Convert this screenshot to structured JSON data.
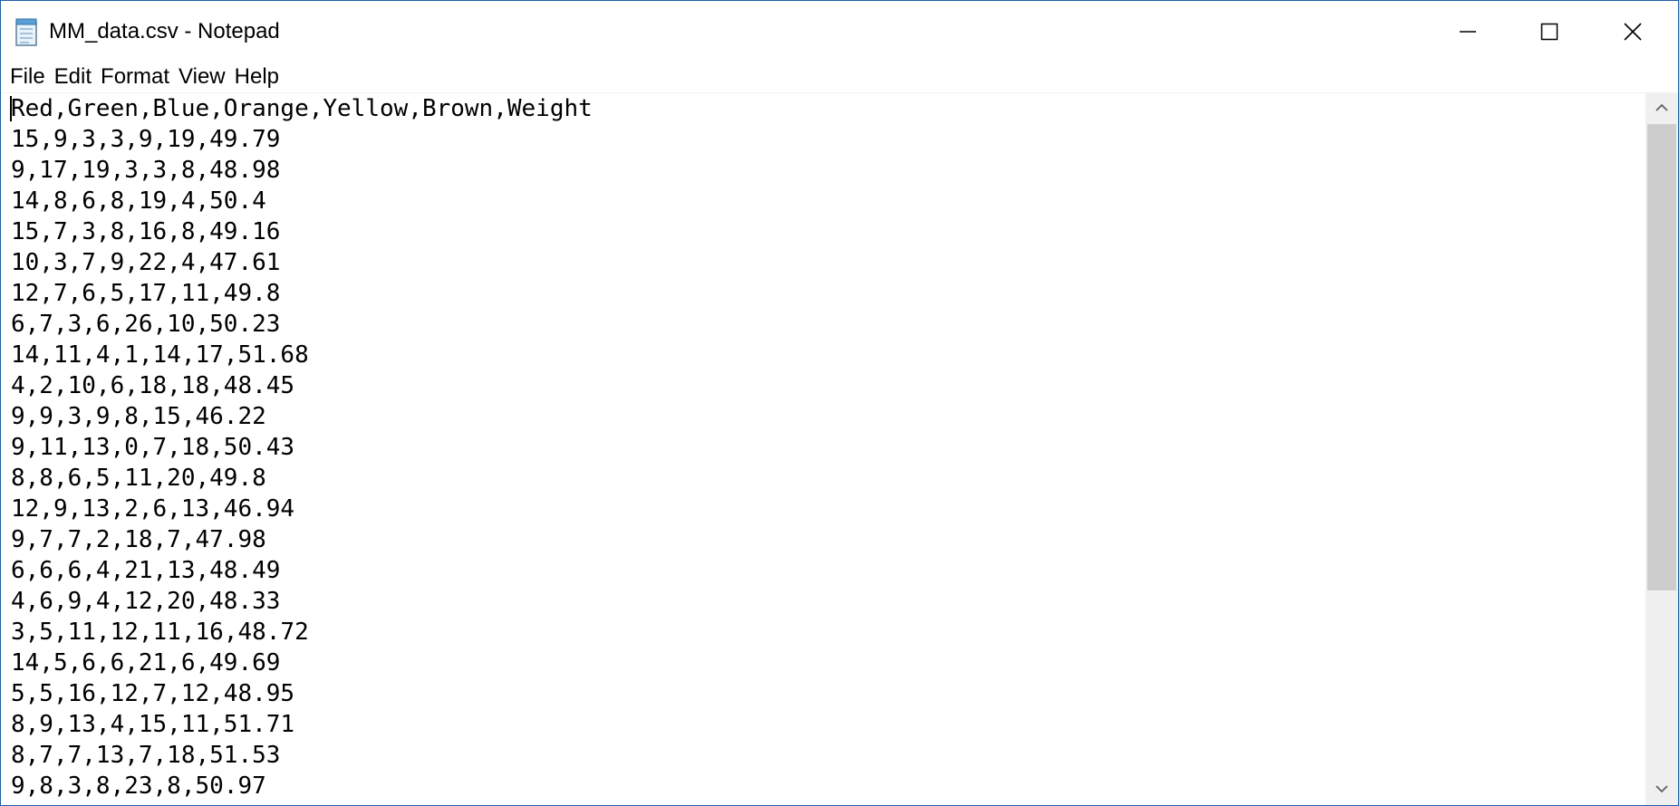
{
  "window": {
    "title": "MM_data.csv - Notepad",
    "icon": "notepad-icon",
    "controls": {
      "minimize": "minimize-icon",
      "maximize": "maximize-icon",
      "close": "close-icon"
    }
  },
  "menu": {
    "items": [
      "File",
      "Edit",
      "Format",
      "View",
      "Help"
    ]
  },
  "document": {
    "lines": [
      "Red,Green,Blue,Orange,Yellow,Brown,Weight",
      "15,9,3,3,9,19,49.79",
      "9,17,19,3,3,8,48.98",
      "14,8,6,8,19,4,50.4",
      "15,7,3,8,16,8,49.16",
      "10,3,7,9,22,4,47.61",
      "12,7,6,5,17,11,49.8",
      "6,7,3,6,26,10,50.23",
      "14,11,4,1,14,17,51.68",
      "4,2,10,6,18,18,48.45",
      "9,9,3,9,8,15,46.22",
      "9,11,13,0,7,18,50.43",
      "8,8,6,5,11,20,49.8",
      "12,9,13,2,6,13,46.94",
      "9,7,7,2,18,7,47.98",
      "6,6,6,4,21,13,48.49",
      "4,6,9,4,12,20,48.33",
      "3,5,11,12,11,16,48.72",
      "14,5,6,6,21,6,49.69",
      "5,5,16,12,7,12,48.95",
      "8,9,13,4,15,11,51.71",
      "8,7,7,13,7,18,51.53",
      "9,8,3,8,23,8,50.97"
    ]
  },
  "scrollbar": {
    "up": "scroll-up-arrow-icon",
    "down": "scroll-down-arrow-icon"
  }
}
